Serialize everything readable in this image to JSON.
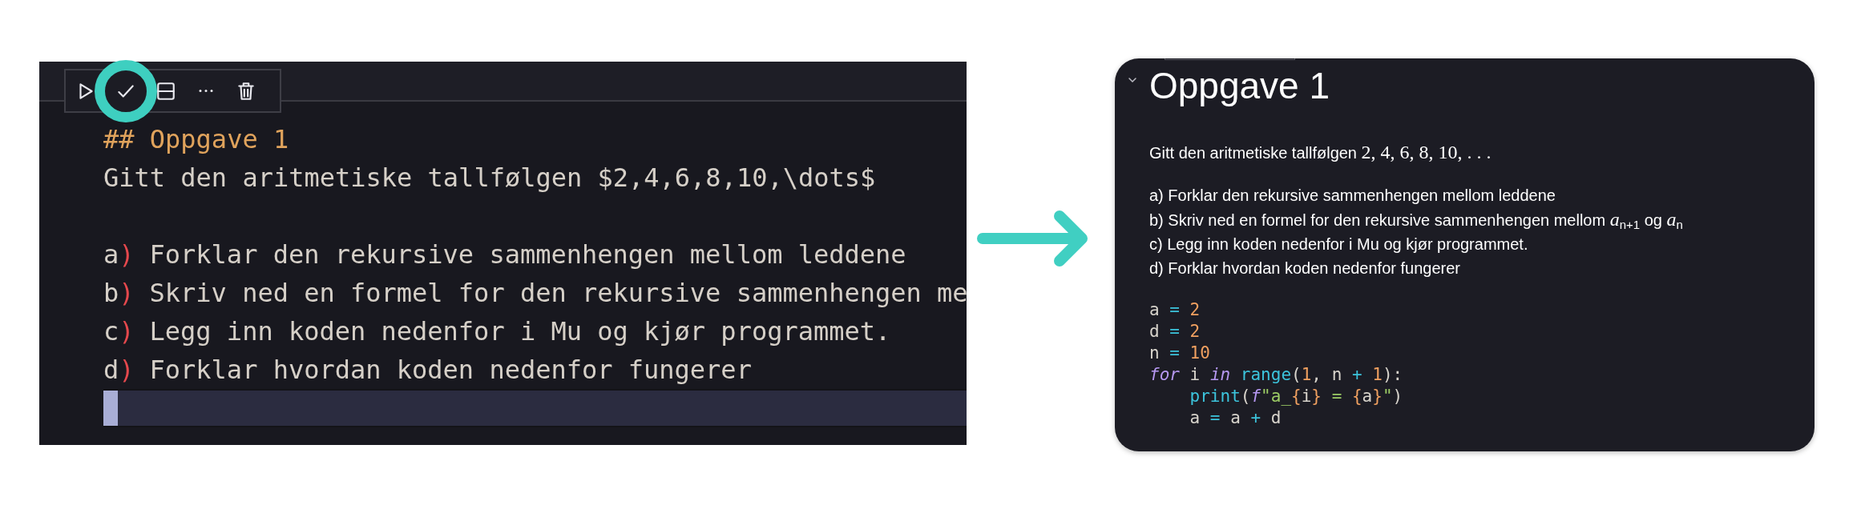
{
  "editor": {
    "toolbar": [
      {
        "kind": "run",
        "highlighted": false
      },
      {
        "kind": "check",
        "highlighted": true
      },
      {
        "kind": "split",
        "highlighted": false
      },
      {
        "kind": "more",
        "highlighted": false
      },
      {
        "kind": "delete",
        "highlighted": false
      }
    ],
    "lines": [
      {
        "kind": "heading",
        "text": "## Oppgave 1"
      },
      {
        "kind": "text",
        "text": "Gitt den aritmetiske tallfølgen $2,4,6,8,10,\\dots$"
      },
      {
        "kind": "blank"
      },
      {
        "kind": "item",
        "marker": "a",
        "paren": ")",
        "text": "Forklar den rekursive sammenhengen mellom leddene"
      },
      {
        "kind": "item",
        "marker": "b",
        "paren": ")",
        "text": "Skriv ned en formel for den rekursive sammenhengen me"
      },
      {
        "kind": "item",
        "marker": "c",
        "paren": ")",
        "text": "Legg inn koden nedenfor i Mu og kjør programmet."
      },
      {
        "kind": "item",
        "marker": "d",
        "paren": ")",
        "text": "Forklar hvordan koden nedenfor fungerer"
      },
      {
        "kind": "cursor"
      }
    ]
  },
  "preview": {
    "expanded": true,
    "heading": "Oppgave 1",
    "intro": {
      "text": "Gitt den aritmetiske tallfølgen",
      "math": "2, 4, 6, 8, 10, . . ."
    },
    "items": [
      "a) Forklar den rekursive sammenhengen mellom leddene",
      "b) Skriv ned en formel for den rekursive sammenhengen mellom *a*$_{n+1}$ og *a*$_{n}$",
      "c) Legg inn koden nedenfor i Mu og kjør programmet.",
      "d) Forklar hvordan koden nedenfor fungerer"
    ],
    "code": [
      {
        "tokens": [
          {
            "t": "a",
            "kind": "var"
          },
          {
            "t": " = ",
            "kind": "op"
          },
          {
            "t": "2",
            "kind": "num"
          }
        ]
      },
      {
        "tokens": [
          {
            "t": "d",
            "kind": "var"
          },
          {
            "t": " = ",
            "kind": "op"
          },
          {
            "t": "2",
            "kind": "num"
          }
        ]
      },
      {
        "tokens": [
          {
            "t": "n",
            "kind": "var"
          },
          {
            "t": " = ",
            "kind": "op"
          },
          {
            "t": "10",
            "kind": "num"
          }
        ]
      },
      {
        "tokens": [
          {
            "t": "for",
            "kind": "kw"
          },
          {
            "t": " i ",
            "kind": "var"
          },
          {
            "t": "in",
            "kind": "kw"
          },
          {
            "t": " range",
            "kind": "fn"
          },
          {
            "t": "(",
            "kind": "var"
          },
          {
            "t": "1",
            "kind": "num"
          },
          {
            "t": ", n ",
            "kind": "var"
          },
          {
            "t": "+",
            "kind": "op"
          },
          {
            "t": " 1",
            "kind": "num"
          },
          {
            "t": "):",
            "kind": "var"
          }
        ]
      },
      {
        "tokens": [
          {
            "t": "    print",
            "kind": "fn"
          },
          {
            "t": "(",
            "kind": "var"
          },
          {
            "t": "f",
            "kind": "kw"
          },
          {
            "t": "\"a_",
            "kind": "str"
          },
          {
            "t": "{",
            "kind": "num"
          },
          {
            "t": "i",
            "kind": "var"
          },
          {
            "t": "}",
            "kind": "num"
          },
          {
            "t": " = ",
            "kind": "str"
          },
          {
            "t": "{",
            "kind": "num"
          },
          {
            "t": "a",
            "kind": "var"
          },
          {
            "t": "}",
            "kind": "num"
          },
          {
            "t": "\"",
            "kind": "str"
          },
          {
            "t": ")",
            "kind": "var"
          }
        ]
      },
      {
        "tokens": [
          {
            "t": "    a",
            "kind": "var"
          },
          {
            "t": " = ",
            "kind": "op"
          },
          {
            "t": "a ",
            "kind": "var"
          },
          {
            "t": "+",
            "kind": "op"
          },
          {
            "t": " d",
            "kind": "var"
          }
        ]
      }
    ]
  }
}
